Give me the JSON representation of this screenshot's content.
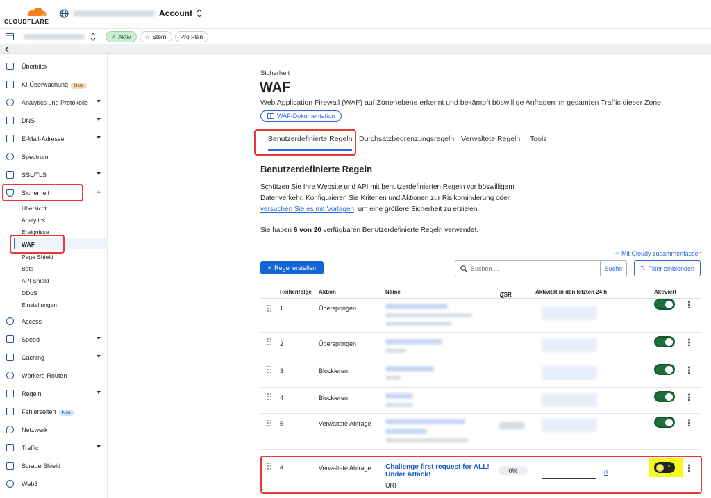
{
  "header": {
    "brand": "CLOUDFLARE",
    "account_label": "Account"
  },
  "zone": {
    "status": "Aktiv",
    "star": "Stern",
    "plan": "Pro Plan"
  },
  "sidebar": {
    "items": [
      {
        "label": "Überblick",
        "icon": "document-icon"
      },
      {
        "label": "KI-Überwachung",
        "icon": "ai-icon",
        "badge": "Beta"
      },
      {
        "label": "Analytics und Protokolle",
        "icon": "analytics-icon",
        "caret": true
      },
      {
        "label": "DNS",
        "icon": "dns-icon",
        "caret": true
      },
      {
        "label": "E-Mail-Adresse",
        "icon": "mail-icon",
        "caret": true
      },
      {
        "label": "Spectrum",
        "icon": "spectrum-icon"
      },
      {
        "label": "SSL/TLS",
        "icon": "lock-icon",
        "caret": true
      },
      {
        "label": "Sicherheit",
        "icon": "shield-icon",
        "caret_up": true
      }
    ],
    "security_sub": [
      "Übersicht",
      "Analytics",
      "Ereignisse",
      "WAF",
      "Page Shield",
      "Bots",
      "API Shield",
      "DDoS",
      "Einstellungen"
    ],
    "items_after": [
      {
        "label": "Access",
        "icon": "access-icon"
      },
      {
        "label": "Speed",
        "icon": "bolt-icon",
        "caret": true
      },
      {
        "label": "Caching",
        "icon": "cache-icon",
        "caret": true
      },
      {
        "label": "Workers-Routen",
        "icon": "workers-icon"
      },
      {
        "label": "Regeln",
        "icon": "rules-icon",
        "caret": true
      },
      {
        "label": "Fehlerseiten",
        "icon": "wrench-icon",
        "badge": "Neu"
      },
      {
        "label": "Netzwerk",
        "icon": "pin-icon"
      },
      {
        "label": "Traffic",
        "icon": "traffic-icon",
        "caret": true
      },
      {
        "label": "Scrape Shield",
        "icon": "scrape-icon"
      },
      {
        "label": "Web3",
        "icon": "web3-icon"
      }
    ]
  },
  "page": {
    "section": "Sicherheit",
    "title": "WAF",
    "description": "Web Application Firewall (WAF) auf Zonenebene erkennt und bekämpft böswillige Anfragen im gesamten Traffic dieser Zone.",
    "doc_button": "WAF-Dokumentation",
    "tabs": [
      "Benutzerdefinierte Regeln",
      "Durchsatzbegrenzungsregeln",
      "Verwaltete Regeln",
      "Tools"
    ],
    "section_title": "Benutzerdefinierte Regeln",
    "para_line1": "Schützen Sie Ihre Website und API mit benutzerdefinierten Regeln vor böswilligem",
    "para_line2": "Datenverkehr. Konfigurieren Sie Kriterien und Aktionen zur Risikominderung oder",
    "para_link": "versuchen Sie es mit Vorlagen",
    "para_tail": ", um eine größere Sicherheit zu erzielen.",
    "count_pre": "Sie haben ",
    "count_bold": "6 von 20",
    "count_post": " verfügbaren Benutzerdefinierte Regeln verwendet.",
    "cloudy": "Mit Cloudy zusammenfassen",
    "create": "Regel erstellen",
    "search_placeholder": "Suchen ...",
    "search_button": "Suche",
    "filter": "Filter einblenden"
  },
  "table": {
    "headers": [
      "Reihenfolge",
      "Aktion",
      "Name",
      "CSR",
      "Aktivität in den letzten 24 h",
      "Aktiviert"
    ],
    "rows": [
      {
        "order": "1",
        "action": "Überspringen",
        "enabled": true
      },
      {
        "order": "2",
        "action": "Überspringen",
        "enabled": true
      },
      {
        "order": "3",
        "action": "Blockieren",
        "enabled": true
      },
      {
        "order": "4",
        "action": "Blockieren",
        "enabled": true
      },
      {
        "order": "5",
        "action": "Verwaltete Abfrage",
        "enabled": true
      },
      {
        "order": "6",
        "action": "Verwaltete Abfrage",
        "name1": "Challenge first request for ALL!",
        "name2": "Under Attack!",
        "sub": "URI",
        "csr": "0%",
        "activity": "0",
        "enabled": false
      }
    ]
  },
  "colors": {
    "accent": "#2f68d8",
    "toggle_on": "#1d6e3a",
    "highlight": "#f4f91d",
    "annotation": "#e53935"
  }
}
